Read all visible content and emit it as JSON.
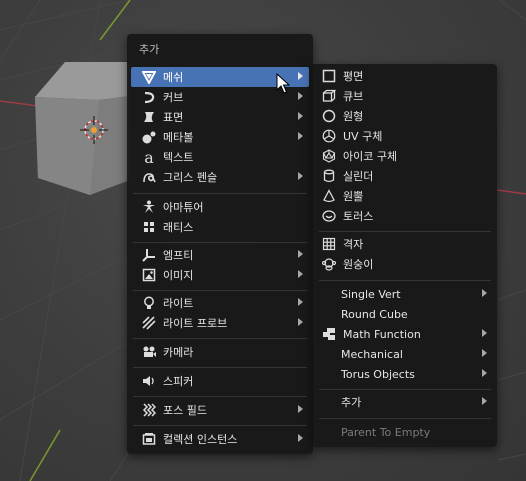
{
  "menu": {
    "title": "추가",
    "items": [
      {
        "label": "메쉬",
        "icon": "mesh-icon"
      },
      {
        "label": "커브",
        "icon": "curve-icon"
      },
      {
        "label": "표면",
        "icon": "surface-icon"
      },
      {
        "label": "메타볼",
        "icon": "metaball-icon"
      },
      {
        "label": "텍스트",
        "icon": "text-icon"
      },
      {
        "label": "그리스 펜슬",
        "icon": "grease-pencil-icon"
      },
      {
        "label": "아마튜어",
        "icon": "armature-icon"
      },
      {
        "label": "래티스",
        "icon": "lattice-icon"
      },
      {
        "label": "엠프티",
        "icon": "empty-icon"
      },
      {
        "label": "이미지",
        "icon": "image-icon"
      },
      {
        "label": "라이트",
        "icon": "light-icon"
      },
      {
        "label": "라이트 프로브",
        "icon": "light-probe-icon"
      },
      {
        "label": "카메라",
        "icon": "camera-icon"
      },
      {
        "label": "스피커",
        "icon": "speaker-icon"
      },
      {
        "label": "포스 필드",
        "icon": "force-field-icon"
      },
      {
        "label": "컬렉션 인스턴스",
        "icon": "collection-instance-icon"
      }
    ]
  },
  "submenu": {
    "items": [
      {
        "label": "평면",
        "icon": "plane-icon"
      },
      {
        "label": "큐브",
        "icon": "cube-icon"
      },
      {
        "label": "원형",
        "icon": "circle-icon"
      },
      {
        "label": "UV 구체",
        "icon": "uv-sphere-icon"
      },
      {
        "label": "아이코 구체",
        "icon": "ico-sphere-icon"
      },
      {
        "label": "실린더",
        "icon": "cylinder-icon"
      },
      {
        "label": "원뿔",
        "icon": "cone-icon"
      },
      {
        "label": "토러스",
        "icon": "torus-icon"
      },
      {
        "label": "격자",
        "icon": "grid-icon"
      },
      {
        "label": "원숭이",
        "icon": "monkey-icon"
      },
      {
        "label": "Single Vert"
      },
      {
        "label": "Round Cube"
      },
      {
        "label": "Math Function",
        "icon": "math-function-icon"
      },
      {
        "label": "Mechanical"
      },
      {
        "label": "Torus Objects"
      },
      {
        "label": "추가"
      },
      {
        "label": "Parent To Empty"
      }
    ]
  },
  "colors": {
    "highlight": "#4772b3",
    "menu_bg": "#181818",
    "viewport_bg": "#3d3d3d",
    "x_axis": "#9b3b45",
    "y_axis": "#7a9a2d"
  }
}
